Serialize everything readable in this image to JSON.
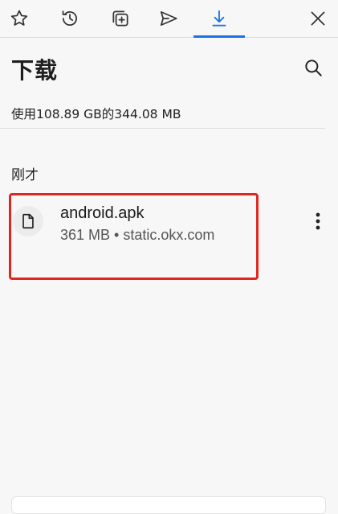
{
  "tabs": [
    {
      "icon": "star-icon",
      "active": false
    },
    {
      "icon": "history-icon",
      "active": false
    },
    {
      "icon": "tab-collection-icon",
      "active": false
    },
    {
      "icon": "send-icon",
      "active": false
    },
    {
      "icon": "download-icon",
      "active": true
    }
  ],
  "header": {
    "title": "下载",
    "search_icon": "search-icon",
    "close_icon": "close-icon"
  },
  "storage_text": "使用108.89 GB的344.08 MB",
  "section_label": "刚才",
  "downloads": [
    {
      "name": "android.apk",
      "meta": "361 MB • static.okx.com",
      "icon": "file-icon",
      "highlighted": true
    }
  ],
  "colors": {
    "accent": "#1a73e8",
    "highlight": "#e0271f",
    "background": "#f7f7f7"
  }
}
